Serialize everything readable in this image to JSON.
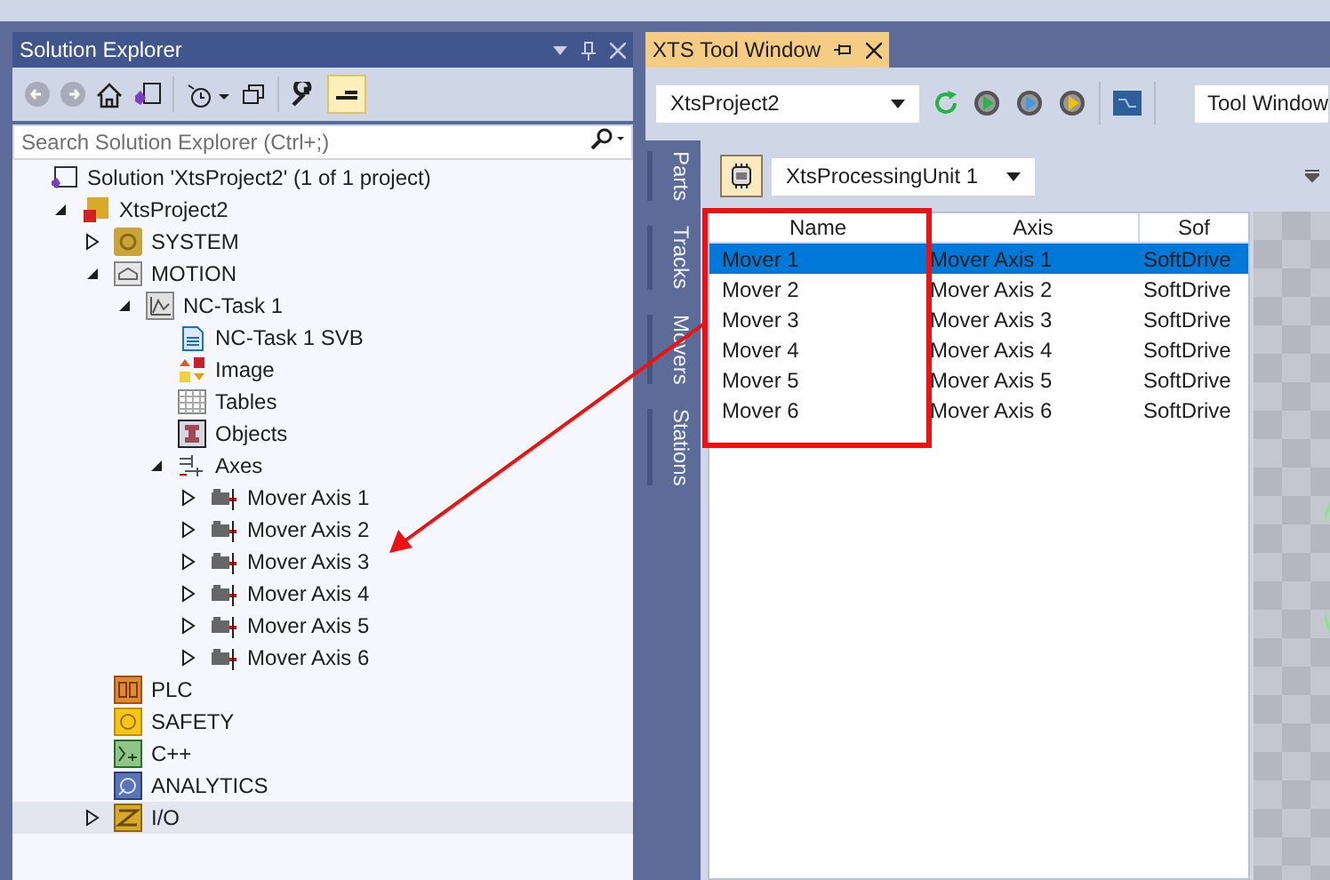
{
  "solution_explorer": {
    "title": "Solution Explorer",
    "toolbar_toggle": {
      "on": true
    },
    "search": {
      "placeholder": "Search Solution Explorer (Ctrl+;)"
    },
    "tree": [
      {
        "kind": "solution",
        "label": "Solution 'XtsProject2' (1 of 1 project)",
        "selected": false,
        "children": [
          {
            "kind": "project",
            "label": "XtsProject2",
            "expanded": true,
            "selected": false,
            "children": [
              {
                "kind": "system",
                "label": "SYSTEM",
                "expanded": false,
                "selected": false
              },
              {
                "kind": "motion",
                "label": "MOTION",
                "expanded": true,
                "selected": false,
                "children": [
                  {
                    "kind": "nctask",
                    "label": "NC-Task 1",
                    "expanded": true,
                    "selected": false,
                    "children": [
                      {
                        "kind": "svb",
                        "label": "NC-Task 1 SVB",
                        "selected": false
                      },
                      {
                        "kind": "image",
                        "label": "Image",
                        "selected": false
                      },
                      {
                        "kind": "tables",
                        "label": "Tables",
                        "selected": false
                      },
                      {
                        "kind": "objects",
                        "label": "Objects",
                        "selected": false
                      },
                      {
                        "kind": "axes",
                        "label": "Axes",
                        "expanded": true,
                        "selected": false,
                        "children": [
                          {
                            "kind": "axis",
                            "label": "Mover Axis 1",
                            "expanded": false,
                            "selected": false
                          },
                          {
                            "kind": "axis",
                            "label": "Mover Axis 2",
                            "expanded": false,
                            "selected": false
                          },
                          {
                            "kind": "axis",
                            "label": "Mover Axis 3",
                            "expanded": false,
                            "selected": false
                          },
                          {
                            "kind": "axis",
                            "label": "Mover Axis 4",
                            "expanded": false,
                            "selected": false
                          },
                          {
                            "kind": "axis",
                            "label": "Mover Axis 5",
                            "expanded": false,
                            "selected": false
                          },
                          {
                            "kind": "axis",
                            "label": "Mover Axis 6",
                            "expanded": false,
                            "selected": false
                          }
                        ]
                      }
                    ]
                  }
                ]
              },
              {
                "kind": "plc",
                "label": "PLC",
                "selected": false
              },
              {
                "kind": "safety",
                "label": "SAFETY",
                "selected": false
              },
              {
                "kind": "cpp",
                "label": "C++",
                "selected": false
              },
              {
                "kind": "analytics",
                "label": "ANALYTICS",
                "selected": false
              },
              {
                "kind": "io",
                "label": "I/O",
                "expanded": false,
                "selected": true
              }
            ]
          }
        ]
      }
    ]
  },
  "xts_tool_window": {
    "tab": {
      "title": "XTS Tool Window"
    },
    "project_dropdown": {
      "value": "XtsProject2"
    },
    "view_dropdown": {
      "value": "Tool Window"
    },
    "side_tabs": [
      {
        "label": "Parts"
      },
      {
        "label": "Tracks"
      },
      {
        "label": "Movers"
      },
      {
        "label": "Stations"
      }
    ],
    "unit_dropdown": {
      "value": "XtsProcessingUnit 1"
    },
    "table": {
      "columns": [
        "Name",
        "Axis",
        "Sof"
      ],
      "rows": [
        {
          "cells": [
            "Mover 1",
            "Mover Axis 1",
            "SoftDrive"
          ],
          "selected": true
        },
        {
          "cells": [
            "Mover 2",
            "Mover Axis 2",
            "SoftDrive"
          ],
          "selected": false
        },
        {
          "cells": [
            "Mover 3",
            "Mover Axis 3",
            "SoftDrive"
          ],
          "selected": false
        },
        {
          "cells": [
            "Mover 4",
            "Mover Axis 4",
            "SoftDrive"
          ],
          "selected": false
        },
        {
          "cells": [
            "Mover 5",
            "Mover Axis 5",
            "SoftDrive"
          ],
          "selected": false
        },
        {
          "cells": [
            "Mover 6",
            "Mover Axis 6",
            "SoftDrive"
          ],
          "selected": false
        }
      ]
    }
  }
}
